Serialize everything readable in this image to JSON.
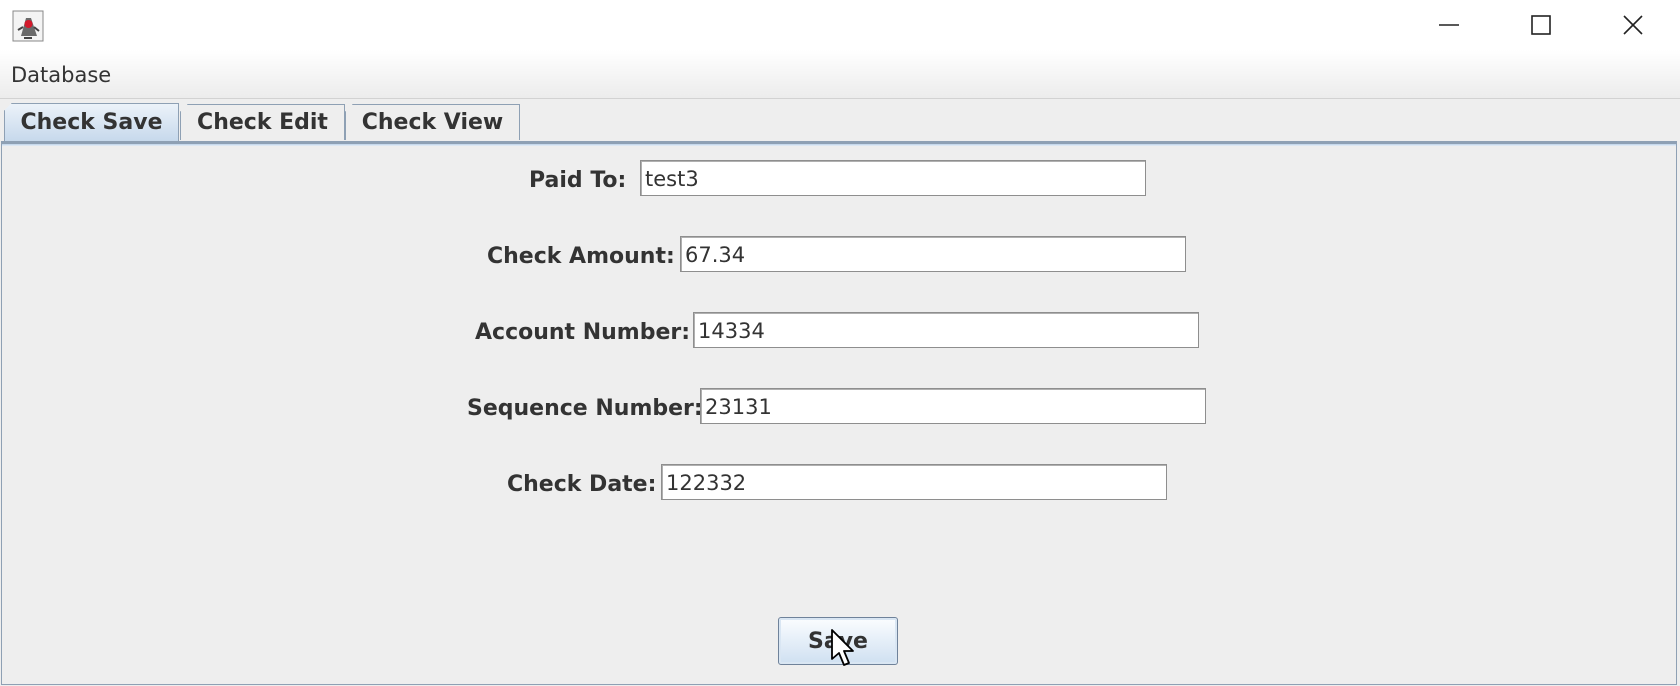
{
  "titlebar": {
    "app_icon": "java-duke-icon",
    "minimize_icon": "minimize-icon",
    "maximize_icon": "maximize-icon",
    "close_icon": "close-icon"
  },
  "menu": {
    "items": [
      {
        "label": "Database"
      }
    ]
  },
  "tabs": [
    {
      "label": "Check Save",
      "selected": true
    },
    {
      "label": "Check Edit",
      "selected": false
    },
    {
      "label": "Check View",
      "selected": false
    }
  ],
  "form": {
    "fields": [
      {
        "label": "Paid To:",
        "value": "test3"
      },
      {
        "label": "Check Amount:",
        "value": "67.34"
      },
      {
        "label": "Account Number:",
        "value": "14334"
      },
      {
        "label": "Sequence Number:",
        "value": "23131"
      },
      {
        "label": "Check Date:",
        "value": "122332"
      }
    ],
    "save_label": "Save"
  },
  "colors": {
    "tab_selected": "#c7d9ec",
    "border_blue": "#8ea0b4",
    "background": "#eeeeee"
  }
}
